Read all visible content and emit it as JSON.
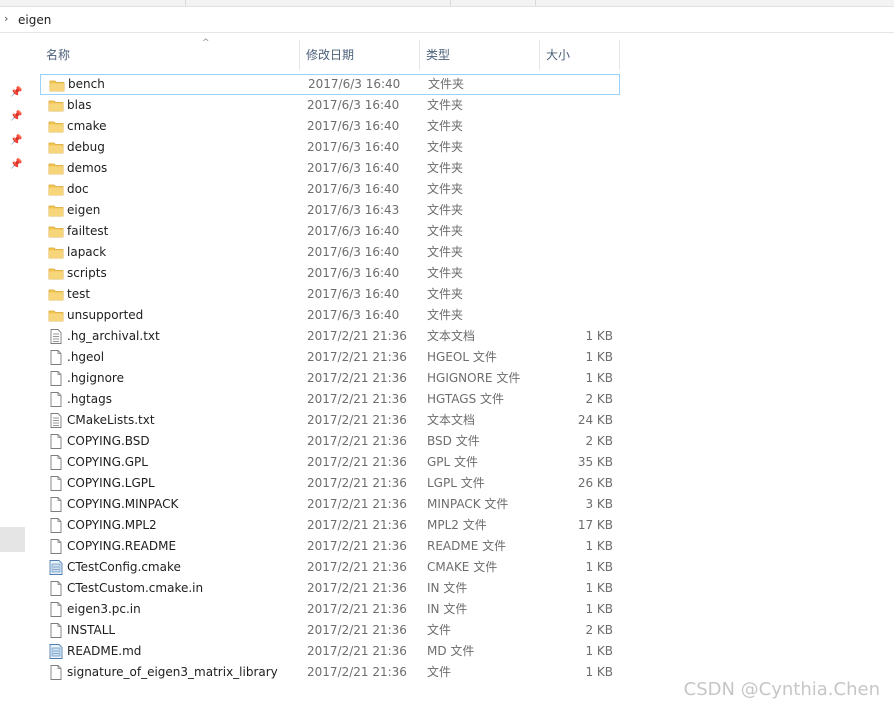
{
  "address": {
    "path": "eigen"
  },
  "columns": {
    "name": "名称",
    "date": "修改日期",
    "type": "类型",
    "size": "大小"
  },
  "colors": {
    "folder": "#f3c652",
    "header_text": "#4c607a",
    "selection_border": "#99d1ff"
  },
  "files": [
    {
      "name": "bench",
      "date": "2017/6/3 16:40",
      "type": "文件夹",
      "size": "",
      "icon": "folder-icon"
    },
    {
      "name": "blas",
      "date": "2017/6/3 16:40",
      "type": "文件夹",
      "size": "",
      "icon": "folder-icon"
    },
    {
      "name": "cmake",
      "date": "2017/6/3 16:40",
      "type": "文件夹",
      "size": "",
      "icon": "folder-icon"
    },
    {
      "name": "debug",
      "date": "2017/6/3 16:40",
      "type": "文件夹",
      "size": "",
      "icon": "folder-icon"
    },
    {
      "name": "demos",
      "date": "2017/6/3 16:40",
      "type": "文件夹",
      "size": "",
      "icon": "folder-icon"
    },
    {
      "name": "doc",
      "date": "2017/6/3 16:40",
      "type": "文件夹",
      "size": "",
      "icon": "folder-icon"
    },
    {
      "name": "eigen",
      "date": "2017/6/3 16:43",
      "type": "文件夹",
      "size": "",
      "icon": "folder-icon"
    },
    {
      "name": "failtest",
      "date": "2017/6/3 16:40",
      "type": "文件夹",
      "size": "",
      "icon": "folder-icon"
    },
    {
      "name": "lapack",
      "date": "2017/6/3 16:40",
      "type": "文件夹",
      "size": "",
      "icon": "folder-icon"
    },
    {
      "name": "scripts",
      "date": "2017/6/3 16:40",
      "type": "文件夹",
      "size": "",
      "icon": "folder-icon"
    },
    {
      "name": "test",
      "date": "2017/6/3 16:40",
      "type": "文件夹",
      "size": "",
      "icon": "folder-icon"
    },
    {
      "name": "unsupported",
      "date": "2017/6/3 16:40",
      "type": "文件夹",
      "size": "",
      "icon": "folder-icon"
    },
    {
      "name": ".hg_archival.txt",
      "date": "2017/2/21 21:36",
      "type": "文本文档",
      "size": "1 KB",
      "icon": "text-file-icon"
    },
    {
      "name": ".hgeol",
      "date": "2017/2/21 21:36",
      "type": "HGEOL 文件",
      "size": "1 KB",
      "icon": "file-icon"
    },
    {
      "name": ".hgignore",
      "date": "2017/2/21 21:36",
      "type": "HGIGNORE 文件",
      "size": "1 KB",
      "icon": "file-icon"
    },
    {
      "name": ".hgtags",
      "date": "2017/2/21 21:36",
      "type": "HGTAGS 文件",
      "size": "2 KB",
      "icon": "file-icon"
    },
    {
      "name": "CMakeLists.txt",
      "date": "2017/2/21 21:36",
      "type": "文本文档",
      "size": "24 KB",
      "icon": "text-file-icon"
    },
    {
      "name": "COPYING.BSD",
      "date": "2017/2/21 21:36",
      "type": "BSD 文件",
      "size": "2 KB",
      "icon": "file-icon"
    },
    {
      "name": "COPYING.GPL",
      "date": "2017/2/21 21:36",
      "type": "GPL 文件",
      "size": "35 KB",
      "icon": "file-icon"
    },
    {
      "name": "COPYING.LGPL",
      "date": "2017/2/21 21:36",
      "type": "LGPL 文件",
      "size": "26 KB",
      "icon": "file-icon"
    },
    {
      "name": "COPYING.MINPACK",
      "date": "2017/2/21 21:36",
      "type": "MINPACK 文件",
      "size": "3 KB",
      "icon": "file-icon"
    },
    {
      "name": "COPYING.MPL2",
      "date": "2017/2/21 21:36",
      "type": "MPL2 文件",
      "size": "17 KB",
      "icon": "file-icon"
    },
    {
      "name": "COPYING.README",
      "date": "2017/2/21 21:36",
      "type": "README 文件",
      "size": "1 KB",
      "icon": "file-icon"
    },
    {
      "name": "CTestConfig.cmake",
      "date": "2017/2/21 21:36",
      "type": "CMAKE 文件",
      "size": "1 KB",
      "icon": "cmake-file-icon"
    },
    {
      "name": "CTestCustom.cmake.in",
      "date": "2017/2/21 21:36",
      "type": "IN 文件",
      "size": "1 KB",
      "icon": "file-icon"
    },
    {
      "name": "eigen3.pc.in",
      "date": "2017/2/21 21:36",
      "type": "IN 文件",
      "size": "1 KB",
      "icon": "file-icon"
    },
    {
      "name": "INSTALL",
      "date": "2017/2/21 21:36",
      "type": "文件",
      "size": "2 KB",
      "icon": "file-icon"
    },
    {
      "name": "README.md",
      "date": "2017/2/21 21:36",
      "type": "MD 文件",
      "size": "1 KB",
      "icon": "md-file-icon"
    },
    {
      "name": "signature_of_eigen3_matrix_library",
      "date": "2017/2/21 21:36",
      "type": "文件",
      "size": "1 KB",
      "icon": "file-icon"
    }
  ],
  "watermark": "CSDN @Cynthia.Chen"
}
